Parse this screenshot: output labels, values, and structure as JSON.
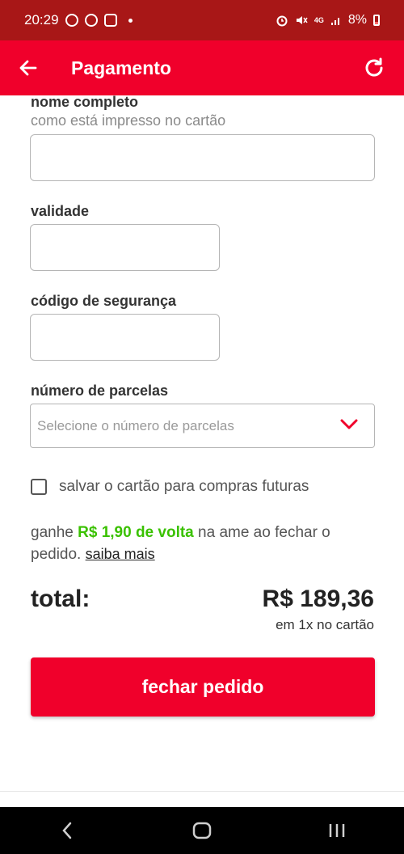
{
  "status_bar": {
    "time": "20:29",
    "network": "4G",
    "battery": "8%"
  },
  "app_bar": {
    "title": "Pagamento",
    "back_icon": "arrow-left-icon",
    "refresh_icon": "refresh-icon"
  },
  "form": {
    "name": {
      "label": "nome completo",
      "sublabel": "como está impresso no cartão",
      "value": ""
    },
    "validity": {
      "label": "validade",
      "value": ""
    },
    "security_code": {
      "label": "código de segurança",
      "value": ""
    },
    "installments": {
      "label": "número de parcelas",
      "placeholder": "Selecione o número de parcelas"
    },
    "save_card": {
      "label": "salvar o cartão para compras futuras",
      "checked": false
    }
  },
  "cashback": {
    "prefix": "ganhe ",
    "amount": "R$ 1,90 de volta",
    "suffix": " na ame ao fechar o pedido. ",
    "link": "saiba mais"
  },
  "total": {
    "label": "total:",
    "value": "R$ 189,36",
    "sub": "em 1x no cartão"
  },
  "cta": {
    "label": "fechar pedido"
  },
  "colors": {
    "brand_red": "#f0002b",
    "status_bar": "#a81717",
    "cashback_green": "#3ac100"
  }
}
